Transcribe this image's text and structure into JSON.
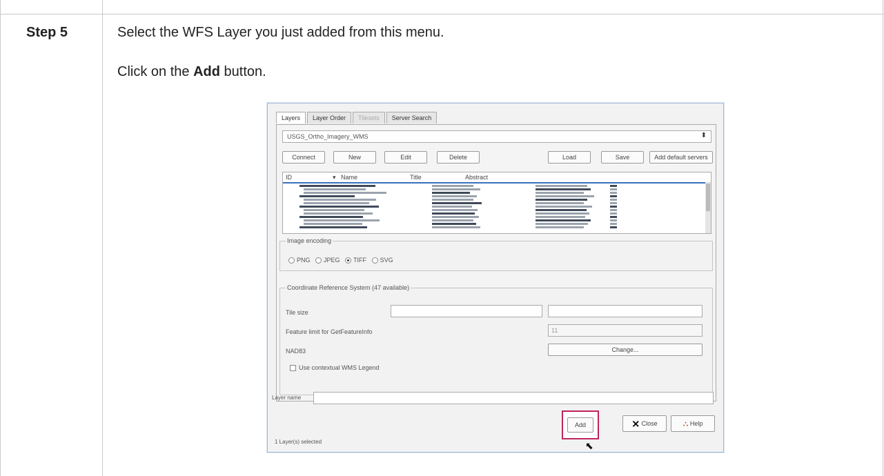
{
  "step": {
    "label": "Step 5",
    "line1": "Select the WFS Layer you just added from this menu.",
    "line2_prefix": "Click on the ",
    "line2_bold": "Add",
    "line2_suffix": " button."
  },
  "dialog": {
    "tabs": [
      {
        "label": "Layers",
        "state": "active"
      },
      {
        "label": "Layer Order",
        "state": "normal"
      },
      {
        "label": "Tilesets",
        "state": "disabled"
      },
      {
        "label": "Server Search",
        "state": "normal"
      }
    ],
    "connection_value": "USGS_Ortho_Imagery_WMS",
    "buttons": {
      "connect": "Connect",
      "new": "New",
      "edit": "Edit",
      "delete": "Delete",
      "load": "Load",
      "save": "Save",
      "add_default": "Add default servers"
    },
    "columns": [
      "ID",
      "Name",
      "Title",
      "Abstract"
    ],
    "image_encoding": {
      "title": "Image encoding",
      "options": [
        {
          "label": "PNG",
          "selected": false
        },
        {
          "label": "JPEG",
          "selected": false
        },
        {
          "label": "TIFF",
          "selected": true
        },
        {
          "label": "SVG",
          "selected": false
        }
      ]
    },
    "crs": {
      "title": "Coordinate Reference System (47 available)",
      "tile_size_label": "Tile size",
      "feature_limit_label": "Feature limit for GetFeatureInfo",
      "feature_limit_value": "11",
      "crs_label": "NAD83",
      "change_label": "Change...",
      "contextual_legend_label": "Use contextual WMS Legend"
    },
    "layer_name_label": "Layer name",
    "status_text": "1 Layer(s) selected",
    "add_label": "Add",
    "close_label": "Close",
    "help_label": "Help"
  }
}
